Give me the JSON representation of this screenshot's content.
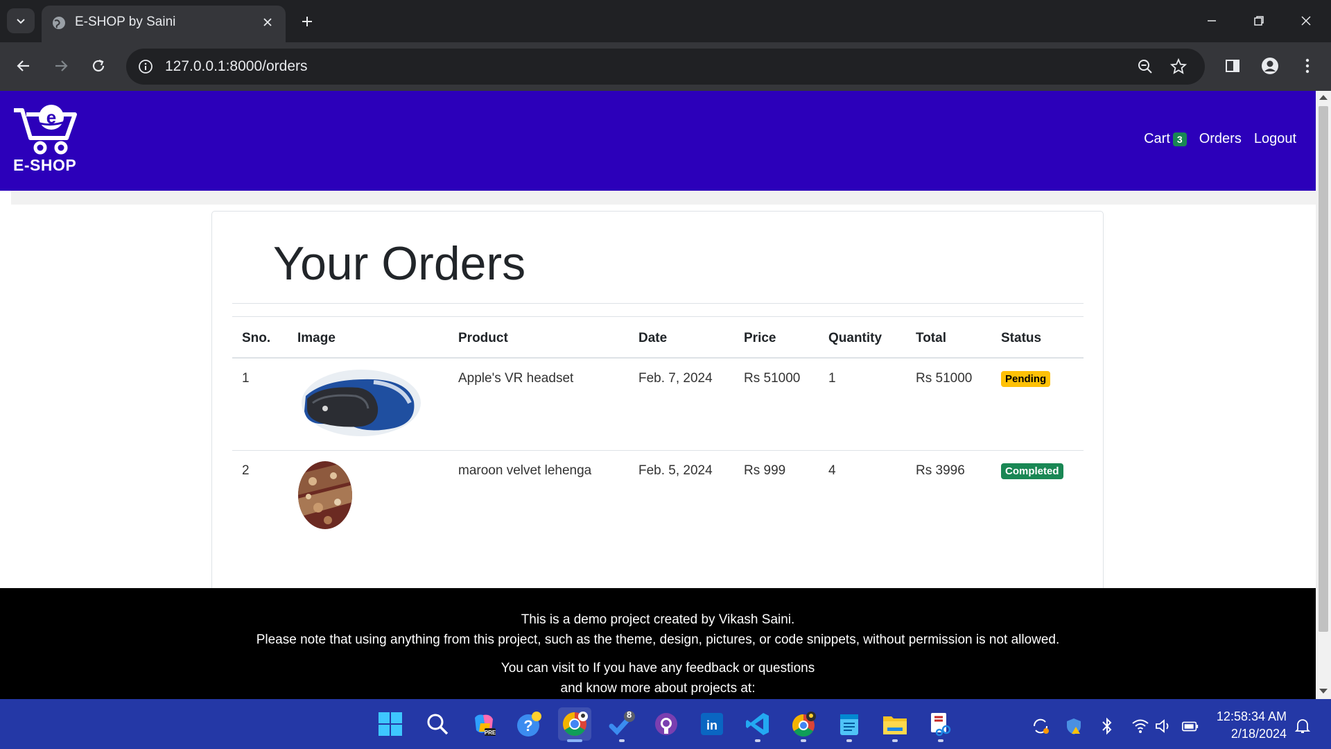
{
  "browser": {
    "tab_title": "E-SHOP by Saini",
    "url": "127.0.0.1:8000/orders"
  },
  "navbar": {
    "logo_text": "E-SHOP",
    "cart_label": "Cart",
    "cart_count": "3",
    "orders_label": "Orders",
    "logout_label": "Logout",
    "brand_color": "#2c00ba"
  },
  "main": {
    "title": "Your Orders",
    "columns": [
      "Sno.",
      "Image",
      "Product",
      "Date",
      "Price",
      "Quantity",
      "Total",
      "Status"
    ],
    "orders": [
      {
        "sno": "1",
        "image_icon": "vr-headset-image",
        "product": "Apple's VR headset",
        "date": "Feb. 7, 2024",
        "price": "Rs 51000",
        "quantity": "1",
        "total": "Rs 51000",
        "status": "Pending",
        "status_color": "#ffc107"
      },
      {
        "sno": "2",
        "image_icon": "lehenga-image",
        "product": "maroon velvet lehenga",
        "date": "Feb. 5, 2024",
        "price": "Rs 999",
        "quantity": "4",
        "total": "Rs 3996",
        "status": "Completed",
        "status_color": "#198754"
      }
    ]
  },
  "footer": {
    "line1": "This is a demo project created by Vikash Saini.",
    "line2": "Please note that using anything from this project, such as the theme, design, pictures, or code snippets, without permission is not allowed.",
    "line3": "You can visit to If you have any feedback or questions",
    "line4": "and know more about projects at:"
  },
  "taskbar": {
    "time": "12:58:34 AM",
    "date": "2/18/2024",
    "todo_badge": "8",
    "apps": [
      "windows-start-icon",
      "search-icon",
      "copilot-icon",
      "help-icon",
      "chrome-icon",
      "todo-icon",
      "github-icon",
      "linkedin-icon",
      "vscode-icon",
      "chrome-beta-icon",
      "notepad-icon",
      "file-explorer-icon",
      "snipping-tool-icon"
    ]
  }
}
